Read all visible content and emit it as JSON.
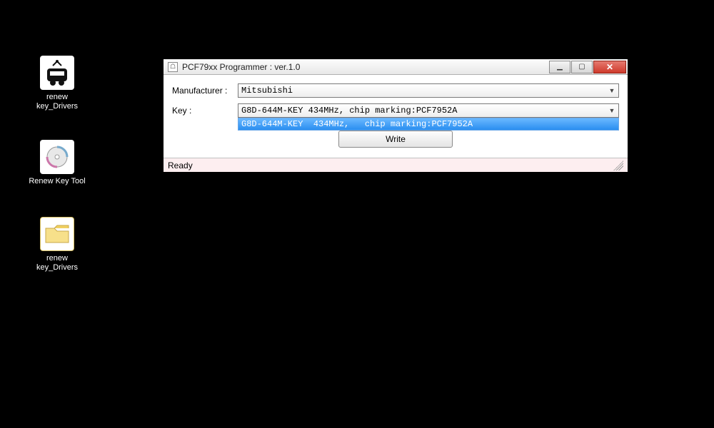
{
  "desktop": {
    "icons": [
      {
        "label": "renew key_Drivers",
        "kind": "prog"
      },
      {
        "label": "Renew Key Tool",
        "kind": "cd"
      },
      {
        "label": "renew key_Drivers",
        "kind": "folder"
      }
    ]
  },
  "window": {
    "title": "PCF79xx Programmer : ver.1.0",
    "labels": {
      "manufacturer": "Manufacturer :",
      "key": "Key :"
    },
    "manufacturer_value": "Mitsubishi",
    "key_value": "G8D-644M-KEY  434MHz,   chip marking:PCF7952A",
    "key_dropdown_open": true,
    "key_options": [
      "G8D-644M-KEY  434MHz,   chip marking:PCF7952A"
    ],
    "write_button": "Write",
    "status": "Ready"
  },
  "icons": {
    "app": "app-icon",
    "minimize": "minimize-icon",
    "maximize": "maximize-icon",
    "close": "close-icon",
    "dropdown": "chevron-down-icon"
  }
}
